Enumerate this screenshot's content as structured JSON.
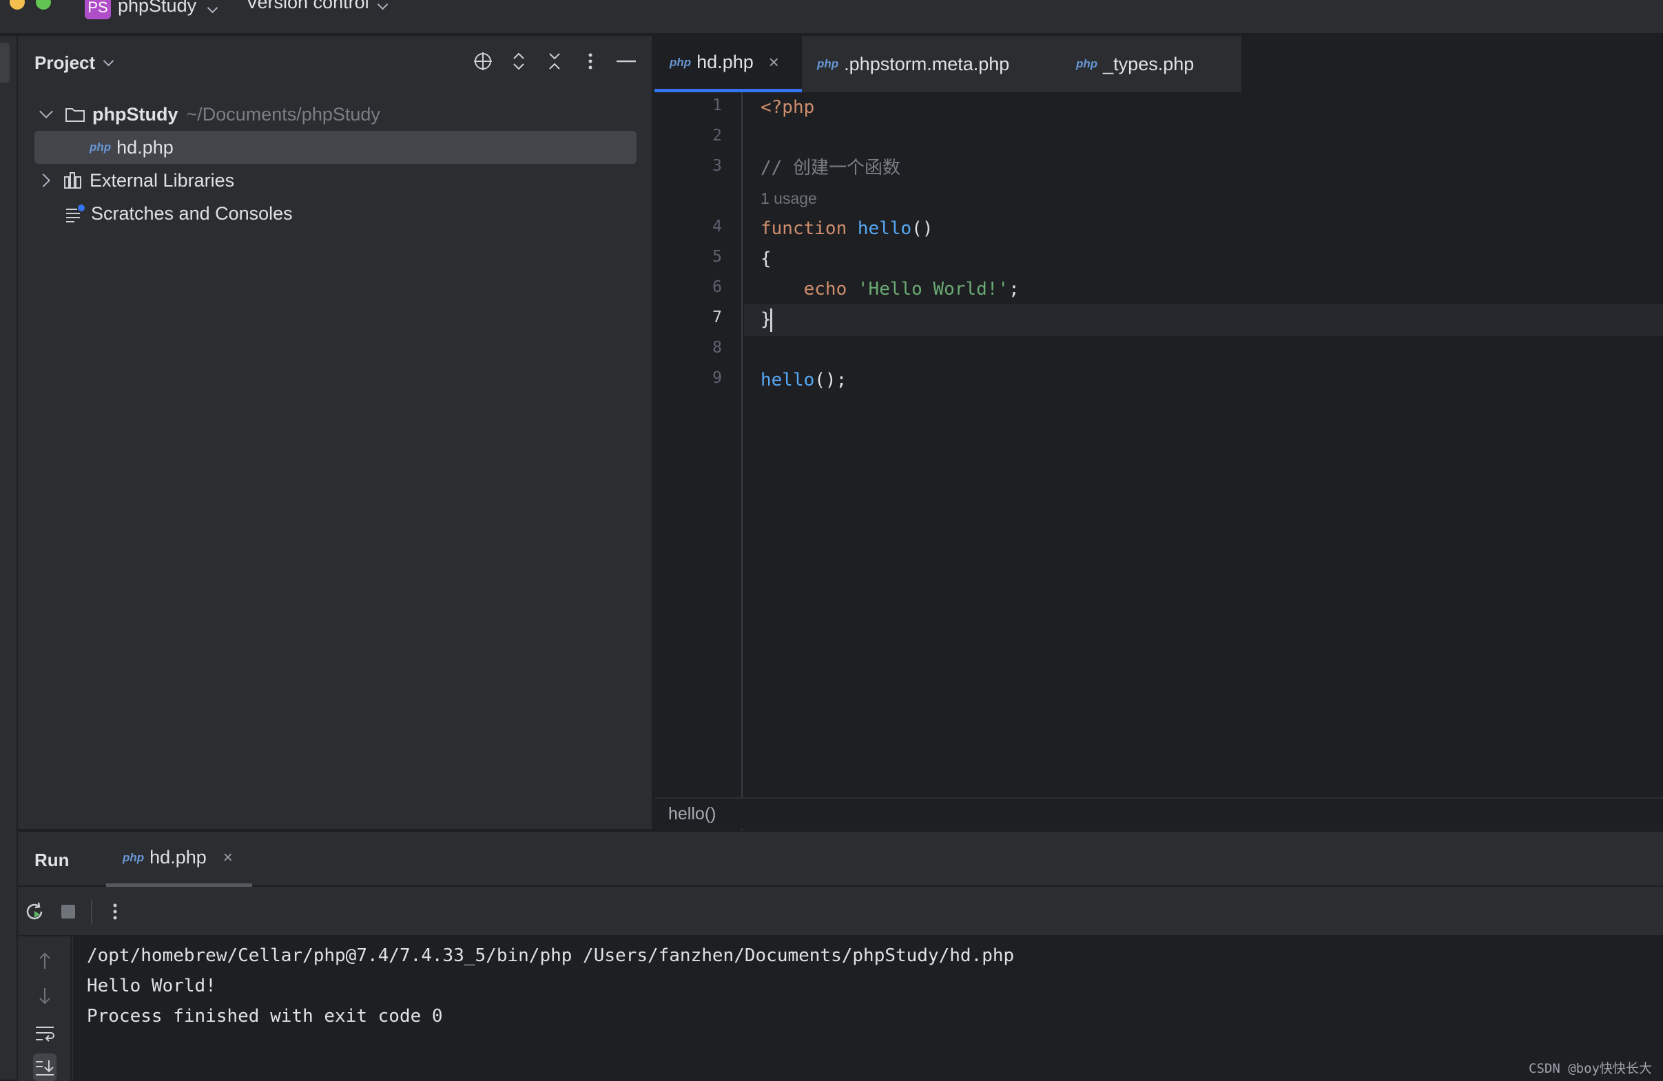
{
  "titlebar": {
    "project_badge": "PS",
    "project_name": "phpStudy",
    "vcs_label": "Version control"
  },
  "project_panel": {
    "title": "Project",
    "tree": {
      "root_name": "phpStudy",
      "root_path": "~/Documents/phpStudy",
      "file_icon": "php",
      "file_name": "hd.php",
      "external_libraries": "External Libraries",
      "scratches": "Scratches and Consoles"
    }
  },
  "editor": {
    "tabs": [
      {
        "icon": "php",
        "label": "hd.php",
        "close": "×"
      },
      {
        "icon": "php",
        "label": ".phpstorm.meta.php"
      },
      {
        "icon": "php",
        "label": "_types.php"
      }
    ],
    "line_numbers": [
      "1",
      "2",
      "3",
      "4",
      "5",
      "6",
      "7",
      "8",
      "9"
    ],
    "current_line": "7",
    "code": {
      "l1": "<?php",
      "l3": "// 创建一个函数",
      "inlay_usage": "1 usage",
      "l4_keyword": "function",
      "l4_name": "hello",
      "l4_parens": "()",
      "l5": "{",
      "l6_keyword": "echo",
      "l6_string": "'Hello World!'",
      "l6_end": ";",
      "l7": "}",
      "l9_name": "hello",
      "l9_end": "();"
    },
    "breadcrumb": "hello()"
  },
  "run_panel": {
    "title": "Run",
    "tab_icon": "php",
    "tab_label": "hd.php",
    "tab_close": "×",
    "console_lines": [
      "/opt/homebrew/Cellar/php@7.4/7.4.33_5/bin/php /Users/fanzhen/Documents/phpStudy/hd.php",
      "Hello World!",
      "Process finished with exit code 0"
    ]
  },
  "watermark": "CSDN @boy快快长大",
  "colors": {
    "accent": "#3574f0",
    "keyword": "#cf8e6d",
    "function": "#56a8f5",
    "string": "#6aab73",
    "background": "#1e1f22",
    "panel": "#2b2d30"
  }
}
